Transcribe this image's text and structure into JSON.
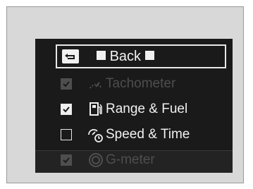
{
  "menu": {
    "back_label": "Back",
    "items": [
      {
        "label": "Tachometer",
        "checked": true,
        "dimmed": true,
        "icon": "tachometer-icon"
      },
      {
        "label": "Range & Fuel",
        "checked": true,
        "dimmed": false,
        "icon": "fuel-icon"
      },
      {
        "label": "Speed & Time",
        "checked": false,
        "dimmed": false,
        "icon": "speed-time-icon"
      },
      {
        "label": "G-meter",
        "checked": true,
        "dimmed": true,
        "icon": "g-meter-icon"
      }
    ]
  }
}
